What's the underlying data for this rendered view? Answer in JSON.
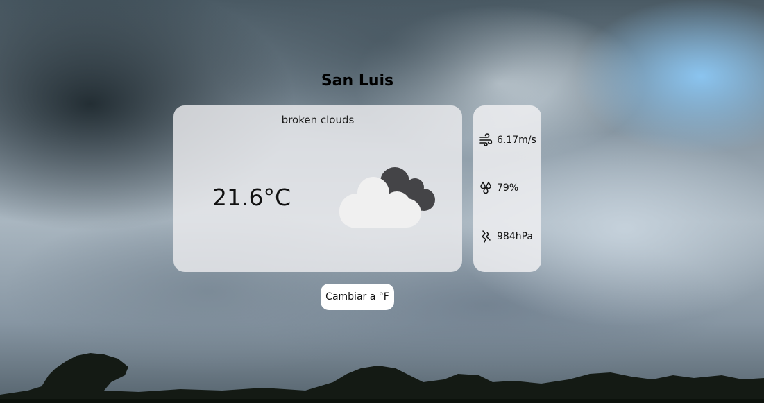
{
  "city": "San Luis",
  "weather": {
    "description": "broken clouds",
    "temperature": "21.6°C",
    "icon": "broken-clouds-icon"
  },
  "stats": {
    "wind": "6.17m/s",
    "humidity": "79%",
    "pressure": "984hPa"
  },
  "toggle": {
    "label": "Cambiar a °F"
  },
  "colors": {
    "card_bg": "#ebebee",
    "button_bg": "#ffffff",
    "text": "#111111",
    "sky_accent": "#8cc8f5"
  }
}
